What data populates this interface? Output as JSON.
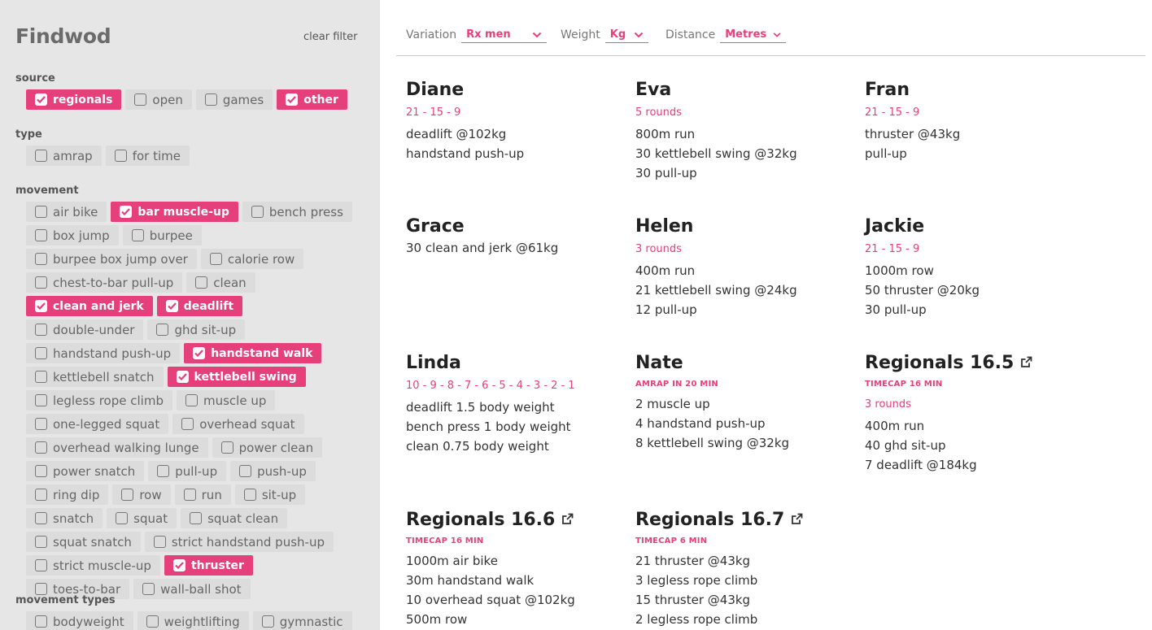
{
  "brand": "Findwod",
  "clear_filter": "clear filter",
  "sections": {
    "source": "source",
    "type": "type",
    "movement": "movement",
    "movement_types": "movement types"
  },
  "source": [
    {
      "label": "regionals",
      "checked": true
    },
    {
      "label": "open",
      "checked": false
    },
    {
      "label": "games",
      "checked": false
    },
    {
      "label": "other",
      "checked": true
    }
  ],
  "type": [
    {
      "label": "amrap",
      "checked": false
    },
    {
      "label": "for time",
      "checked": false
    }
  ],
  "movement": [
    {
      "label": "air bike",
      "checked": false
    },
    {
      "label": "bar muscle-up",
      "checked": true
    },
    {
      "label": "bench press",
      "checked": false
    },
    {
      "label": "box jump",
      "checked": false
    },
    {
      "label": "burpee",
      "checked": false
    },
    {
      "label": "burpee box jump over",
      "checked": false
    },
    {
      "label": "calorie row",
      "checked": false
    },
    {
      "label": "chest-to-bar pull-up",
      "checked": false
    },
    {
      "label": "clean",
      "checked": false
    },
    {
      "label": "clean and jerk",
      "checked": true
    },
    {
      "label": "deadlift",
      "checked": true
    },
    {
      "label": "double-under",
      "checked": false
    },
    {
      "label": "ghd sit-up",
      "checked": false
    },
    {
      "label": "handstand push-up",
      "checked": false
    },
    {
      "label": "handstand walk",
      "checked": true
    },
    {
      "label": "kettlebell snatch",
      "checked": false
    },
    {
      "label": "kettlebell swing",
      "checked": true
    },
    {
      "label": "legless rope climb",
      "checked": false
    },
    {
      "label": "muscle up",
      "checked": false
    },
    {
      "label": "one-legged squat",
      "checked": false
    },
    {
      "label": "overhead squat",
      "checked": false
    },
    {
      "label": "overhead walking lunge",
      "checked": false
    },
    {
      "label": "power clean",
      "checked": false
    },
    {
      "label": "power snatch",
      "checked": false
    },
    {
      "label": "pull-up",
      "checked": false
    },
    {
      "label": "push-up",
      "checked": false
    },
    {
      "label": "ring dip",
      "checked": false
    },
    {
      "label": "row",
      "checked": false
    },
    {
      "label": "run",
      "checked": false
    },
    {
      "label": "sit-up",
      "checked": false
    },
    {
      "label": "snatch",
      "checked": false
    },
    {
      "label": "squat",
      "checked": false
    },
    {
      "label": "squat clean",
      "checked": false
    },
    {
      "label": "squat snatch",
      "checked": false
    },
    {
      "label": "strict handstand push-up",
      "checked": false
    },
    {
      "label": "strict muscle-up",
      "checked": false
    },
    {
      "label": "thruster",
      "checked": true
    },
    {
      "label": "toes-to-bar",
      "checked": false
    },
    {
      "label": "wall-ball shot",
      "checked": false
    }
  ],
  "movement_types": [
    {
      "label": "bodyweight",
      "checked": false
    },
    {
      "label": "weightlifting",
      "checked": false
    },
    {
      "label": "gymnastic",
      "checked": false
    }
  ],
  "filters": {
    "variation": {
      "label": "Variation",
      "value": "Rx men"
    },
    "weight": {
      "label": "Weight",
      "value": "Kg"
    },
    "distance": {
      "label": "Distance",
      "value": "Metres"
    }
  },
  "accent_color": "#e6407a",
  "workouts": [
    {
      "name": "Diane",
      "scheme": "21 - 15 - 9",
      "movements": [
        "deadlift @102kg",
        "handstand push-up"
      ]
    },
    {
      "name": "Eva",
      "scheme": "5 rounds",
      "movements": [
        "800m run",
        "30 kettlebell swing @32kg",
        "30 pull-up"
      ]
    },
    {
      "name": "Fran",
      "scheme": "21 - 15 - 9",
      "movements": [
        "thruster @43kg",
        "pull-up"
      ]
    },
    {
      "name": "Grace",
      "movements": [
        "30 clean and jerk @61kg"
      ]
    },
    {
      "name": "Helen",
      "scheme": "3 rounds",
      "movements": [
        "400m run",
        "21 kettlebell swing @24kg",
        "12 pull-up"
      ]
    },
    {
      "name": "Jackie",
      "scheme": "21 - 15 - 9",
      "movements": [
        "1000m row",
        "50 thruster @20kg",
        "30 pull-up"
      ]
    },
    {
      "name": "Linda",
      "scheme": "10 - 9 - 8 - 7 - 6 - 5 - 4 - 3 - 2 - 1",
      "movements": [
        "deadlift 1.5 body weight",
        "bench press 1 body weight",
        "clean 0.75 body weight"
      ]
    },
    {
      "name": "Nate",
      "tag": "AMRAP IN 20 MIN",
      "movements": [
        "2 muscle up",
        "4 handstand push-up",
        "8 kettlebell swing @32kg"
      ]
    },
    {
      "name": "Regionals 16.5",
      "external_link": true,
      "tag": "TIMECAP 16 MIN",
      "scheme": "3 rounds",
      "movements": [
        "400m run",
        "40 ghd sit-up",
        "7 deadlift @184kg"
      ]
    },
    {
      "name": "Regionals 16.6",
      "external_link": true,
      "tag": "TIMECAP 16 MIN",
      "movements": [
        "1000m air bike",
        "30m handstand walk",
        "10 overhead squat @102kg",
        "500m row"
      ]
    },
    {
      "name": "Regionals 16.7",
      "external_link": true,
      "tag": "TIMECAP 6 MIN",
      "movements": [
        "21 thruster @43kg",
        "3 legless rope climb",
        "15 thruster @43kg",
        "2 legless rope climb"
      ]
    }
  ]
}
